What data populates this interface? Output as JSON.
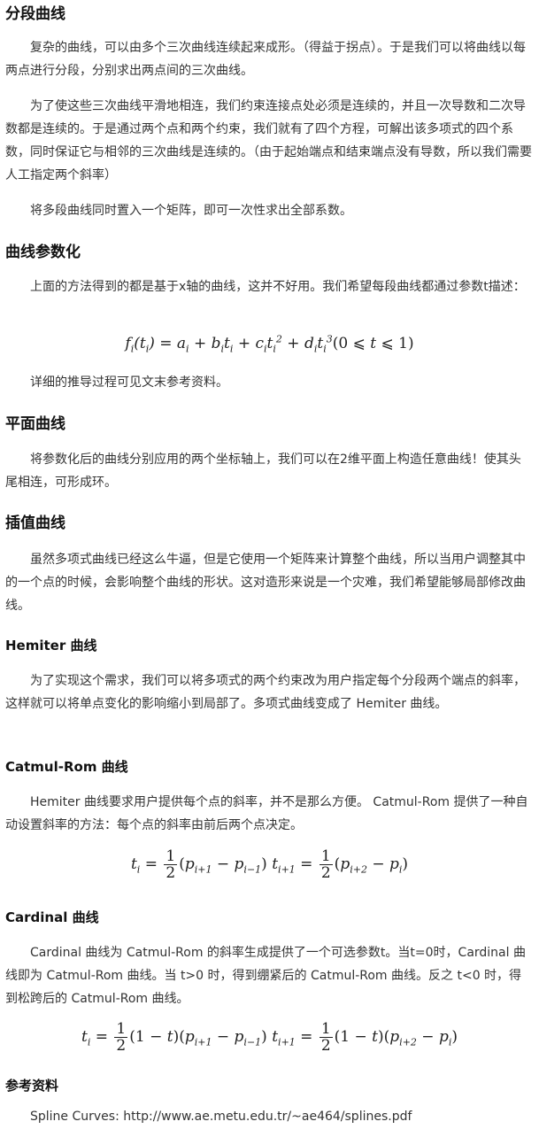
{
  "sections": {
    "s1": {
      "title": "分段曲线",
      "p1": "复杂的曲线，可以由多个三次曲线连续起来成形。（得益于拐点）。于是我们可以将曲线以每两点进行分段，分别求出两点间的三次曲线。",
      "p2": "为了使这些三次曲线平滑地相连，我们约束连接点处必须是连续的，并且一次导数和二次导数都是连续的。于是通过两个点和两个约束，我们就有了四个方程，可解出该多项式的四个系数，同时保证它与相邻的三次曲线是连续的。（由于起始端点和结束端点没有导数，所以我们需要人工指定两个斜率）",
      "p3": "将多段曲线同时置入一个矩阵，即可一次性求出全部系数。"
    },
    "s2": {
      "title": "曲线参数化",
      "p1": "上面的方法得到的都是基于x轴的曲线，这并不好用。我们希望每段曲线都通过参数t描述：",
      "formula": "f_i(t_i) = a_i + b_i t_i + c_i t_i^2 + d_i t_i^3 (0 ≤ t ≤ 1)",
      "p2": "详细的推导过程可见文末参考资料。"
    },
    "s3": {
      "title": "平面曲线",
      "p1": "将参数化后的曲线分别应用的两个坐标轴上，我们可以在2维平面上构造任意曲线！使其头尾相连，可形成环。"
    },
    "s4": {
      "title": "插值曲线",
      "p1": "虽然多项式曲线已经这么牛逼，但是它使用一个矩阵来计算整个曲线，所以当用户调整其中的一个点的时候，会影响整个曲线的形状。这对造形来说是一个灾难，我们希望能够局部修改曲线。"
    },
    "s5": {
      "title": "Hemiter 曲线",
      "p1": "为了实现这个需求，我们可以将多项式的两个约束改为用户指定每个分段两个端点的斜率，这样就可以将单点变化的影响缩小到局部了。多项式曲线变成了 Hemiter 曲线。"
    },
    "s6": {
      "title": "Catmul-Rom 曲线",
      "p1": "Hemiter 曲线要求用户提供每个点的斜率，并不是那么方便。 Catmul-Rom 提供了一种自动设置斜率的方法：每个点的斜率由前后两个点决定。",
      "formula": "t_i = 1/2 (p_{i+1} − p_{i−1}) t_{i+1} = 1/2 (p_{i+2} − p_i)"
    },
    "s7": {
      "title": "Cardinal 曲线",
      "p1": "Cardinal 曲线为 Catmul-Rom 的斜率生成提供了一个可选参数t。当t=0时，Cardinal 曲线即为 Catmul-Rom 曲线。当 t>0 时，得到绷紧后的 Catmul-Rom 曲线。反之 t<0 时，得到松跨后的 Catmul-Rom 曲线。",
      "formula": "t_i = 1/2 (1 − t)(p_{i+1} − p_{i−1}) t_{i+1} = 1/2 (1 − t)(p_{i+2} − p_i)"
    },
    "refs": {
      "title": "参考资料",
      "item1": "Spline Curves: http://www.ae.metu.edu.tr/~ae464/splines.pdf"
    }
  }
}
